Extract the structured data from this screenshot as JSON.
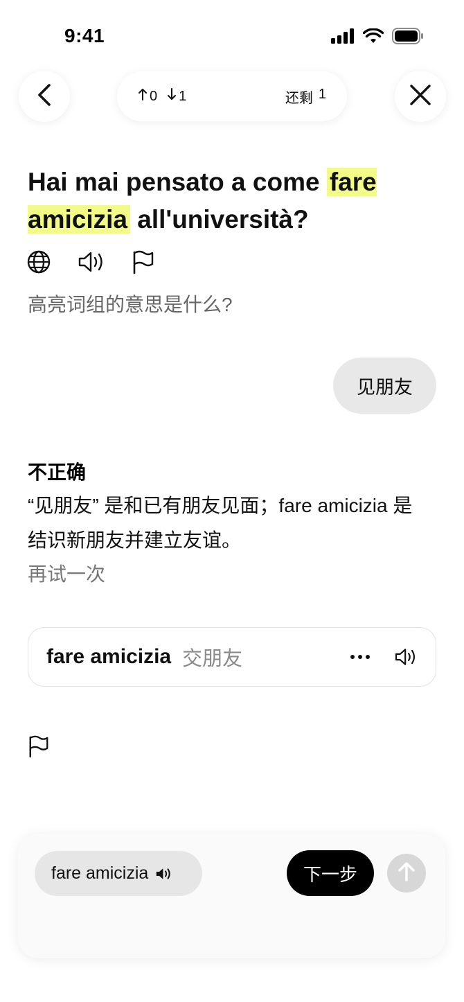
{
  "status_bar": {
    "time": "9:41"
  },
  "nav": {
    "back_icon": "chevron-left-icon",
    "close_icon": "close-icon",
    "score_up": "0",
    "score_down": "1",
    "remaining_label": "还剩",
    "remaining_count": "1"
  },
  "question": {
    "before": "Hai mai pensato a come ",
    "highlight": "fare amicizia",
    "after": " all'università?",
    "highlight_color": "#f3fb88",
    "tools": [
      "globe-icon",
      "speaker-icon",
      "flag-icon"
    ],
    "prompt": "高亮词组的意思是什么?"
  },
  "answer": {
    "text": "见朋友"
  },
  "feedback": {
    "title": "不正确",
    "body": "“见朋友” 是和已有朋友见面；fare amicizia 是结识新朋友并建立友谊。",
    "retry": "再试一次"
  },
  "phrase_card": {
    "term": "fare amicizia",
    "translation": "交朋友",
    "more_icon": "ellipsis-icon",
    "sound_icon": "speaker-icon"
  },
  "bottom": {
    "chip_label": "fare amicizia",
    "next_label": "下一步",
    "send_icon": "arrow-up-icon"
  }
}
